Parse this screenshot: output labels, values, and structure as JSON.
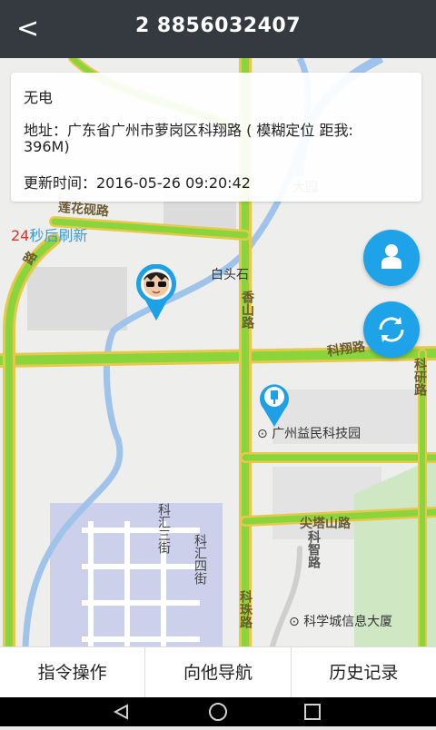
{
  "header": {
    "back_icon": "chevron-left-icon",
    "title": "2  8856032407"
  },
  "info": {
    "power": "无电",
    "address_line1": "地址：广东省广州市萝岗区科翔路 ( 模糊定位 距我:",
    "address_line2": "396M)",
    "updated": "更新时间：2016-05-26 09:20:42"
  },
  "refresh": {
    "seconds": "24",
    "suffix": "秒后刷新"
  },
  "map": {
    "labels": {
      "dayuan": "大园",
      "baitoushi": "白头石",
      "xiangshan": "香山路",
      "kexiang": "科翔路",
      "kenyan": "科研路",
      "poi_yimin": "广州益民科技园",
      "jiantashan": "尖塔山路",
      "kezhi": "科智路",
      "kehui3": "科汇三街",
      "kehui4": "科汇四街",
      "kezhu": "科珠路",
      "poi_kxc": "科学城信息大厦",
      "lianhua": "莲花砚路",
      "west_road": "路"
    },
    "road_color": "#8ad43c",
    "road_edge": "#e6c94a"
  },
  "buttons": {
    "person_icon": "person-icon",
    "refresh_icon": "refresh-icon"
  },
  "bottom": {
    "commands": "指令操作",
    "navigate": "向他导航",
    "history": "历史记录"
  },
  "navbar": {
    "back": "back-triangle-icon",
    "home": "home-circle-icon",
    "recent": "recent-square-icon"
  }
}
